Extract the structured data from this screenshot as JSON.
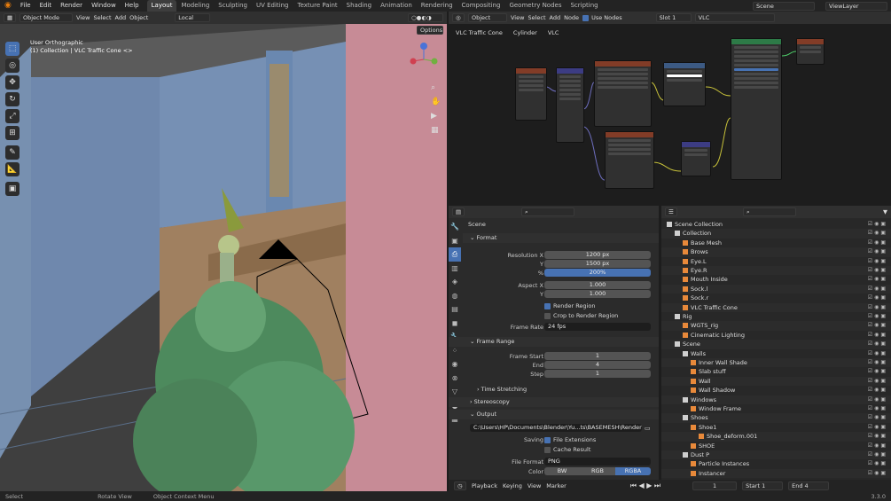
{
  "topbar": {
    "menus": [
      "File",
      "Edit",
      "Render",
      "Window",
      "Help"
    ],
    "workspaces": [
      "Layout",
      "Modeling",
      "Sculpting",
      "UV Editing",
      "Texture Paint",
      "Shading",
      "Animation",
      "Rendering",
      "Compositing",
      "Geometry Nodes",
      "Scripting"
    ],
    "active_workspace": "Layout",
    "scene": "Scene",
    "view_layer": "ViewLayer"
  },
  "viewport": {
    "mode": "Object Mode",
    "menus": [
      "View",
      "Select",
      "Add",
      "Object"
    ],
    "transform": "Local",
    "overlay_title": "User Orthographic",
    "overlay_subtitle": "(1) Collection | VLC Traffic Cone <>",
    "options_label": "Options"
  },
  "node_editor": {
    "type": "Object",
    "menus": [
      "View",
      "Select",
      "Add",
      "Node"
    ],
    "use_nodes_label": "Use Nodes",
    "slot": "Slot 1",
    "material": "VLC",
    "breadcrumb": [
      "VLC Traffic Cone",
      "Cylinder",
      "VLC"
    ]
  },
  "properties": {
    "title": "Scene",
    "format_label": "Format",
    "resolution_x_label": "Resolution X",
    "resolution_x": "1200 px",
    "y_label": "Y",
    "resolution_y": "1500 px",
    "percent_label": "%",
    "percent": "200%",
    "aspect_x_label": "Aspect X",
    "aspect_x": "1.000",
    "aspect_y": "1.000",
    "render_region": "Render Region",
    "crop_region": "Crop to Render Region",
    "frame_rate_label": "Frame Rate",
    "frame_rate": "24 fps",
    "frame_range_label": "Frame Range",
    "frame_start_label": "Frame Start",
    "frame_start": "1",
    "end_label": "End",
    "frame_end": "4",
    "step_label": "Step",
    "step": "1",
    "time_stretching": "Time Stretching",
    "stereoscopy": "Stereoscopy",
    "output_label": "Output",
    "output_path": "C:\\Users\\HP\\Documents\\Blender\\Yu...ts\\BASEMESH\\Render\\Final Renders\\",
    "saving_label": "Saving",
    "file_extensions": "File Extensions",
    "cache_result": "Cache Result",
    "file_format_label": "File Format",
    "file_format": "PNG",
    "color_label": "Color",
    "color_options": [
      "BW",
      "RGB",
      "RGBA"
    ]
  },
  "outliner": {
    "rows": [
      {
        "label": "Scene Collection",
        "indent": 0
      },
      {
        "label": "Collection",
        "indent": 1
      },
      {
        "label": "Base Mesh",
        "indent": 2
      },
      {
        "label": "Brows",
        "indent": 2
      },
      {
        "label": "Eye.L",
        "indent": 2
      },
      {
        "label": "Eye.R",
        "indent": 2
      },
      {
        "label": "Mouth Inside",
        "indent": 2
      },
      {
        "label": "Sock.l",
        "indent": 2
      },
      {
        "label": "Sock.r",
        "indent": 2
      },
      {
        "label": "VLC Traffic Cone",
        "indent": 2
      },
      {
        "label": "Rig",
        "indent": 1
      },
      {
        "label": "WGTS_rig",
        "indent": 2
      },
      {
        "label": "Cinematic Lighting",
        "indent": 2
      },
      {
        "label": "Scene",
        "indent": 1
      },
      {
        "label": "Walls",
        "indent": 2
      },
      {
        "label": "Inner Wall Shade",
        "indent": 3
      },
      {
        "label": "Slab stuff",
        "indent": 3
      },
      {
        "label": "Wall",
        "indent": 3
      },
      {
        "label": "Wall Shadow",
        "indent": 3
      },
      {
        "label": "Windows",
        "indent": 2
      },
      {
        "label": "Window Frame",
        "indent": 3
      },
      {
        "label": "Shoes",
        "indent": 2
      },
      {
        "label": "Shoe1",
        "indent": 3
      },
      {
        "label": "Shoe_deform.001",
        "indent": 4
      },
      {
        "label": "SHOE",
        "indent": 3
      },
      {
        "label": "Dust P",
        "indent": 2
      },
      {
        "label": "Particle Instances",
        "indent": 3
      },
      {
        "label": "Instancer",
        "indent": 3
      }
    ]
  },
  "timeline": {
    "menus": [
      "Playback",
      "Keying",
      "View",
      "Marker"
    ],
    "current_frame": "1",
    "start_label": "Start",
    "start": "1",
    "end_label": "End",
    "end": "4"
  },
  "statusbar": {
    "items": [
      "Select",
      "Rotate View",
      "Object Context Menu"
    ],
    "version": "3.3.0"
  }
}
